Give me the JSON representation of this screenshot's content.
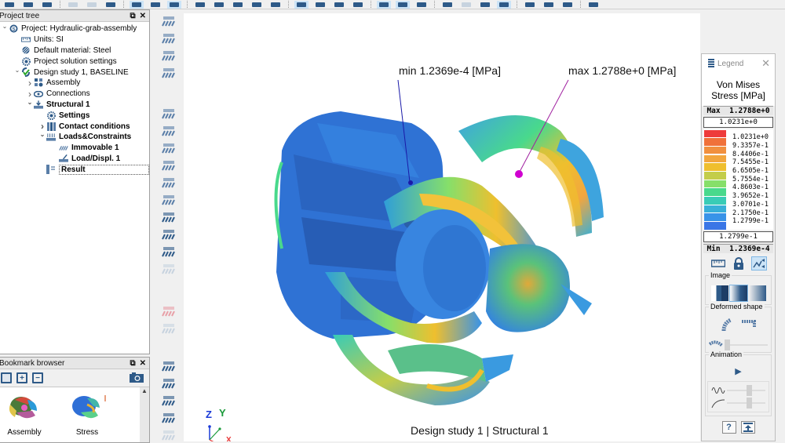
{
  "toolbar": {
    "buttons": [
      "select",
      "fit",
      "rotate",
      "pan",
      "zoom",
      "section",
      "view-list",
      "comment",
      "display",
      "edges",
      "vertices",
      "orbit",
      "undo-view",
      "redo-view",
      "render",
      "solid",
      "wire",
      "surface",
      "probe",
      "isolate",
      "more",
      "result-mode",
      "result-plot",
      "split",
      "animate",
      "scale",
      "deform",
      "sphere",
      "more"
    ]
  },
  "project_tree": {
    "title": "Project tree",
    "items": [
      {
        "label": "Project: Hydraulic-grab-assembly",
        "icon": "project-icon",
        "level": 0,
        "expanded": true,
        "bold": false
      },
      {
        "label": "Units: SI",
        "icon": "ruler-icon",
        "level": 1,
        "bold": false
      },
      {
        "label": "Default material: Steel",
        "icon": "material-icon",
        "level": 1,
        "bold": false
      },
      {
        "label": "Project solution settings",
        "icon": "gear-icon",
        "level": 1,
        "bold": false
      },
      {
        "label": "Design study 1, BASELINE",
        "icon": "design-study-icon",
        "level": 1,
        "expanded": true,
        "bold": false
      },
      {
        "label": "Assembly",
        "icon": "assembly-icon",
        "level": 2,
        "expanded": false,
        "bold": false
      },
      {
        "label": "Connections",
        "icon": "connections-icon",
        "level": 2,
        "expanded": false,
        "bold": false
      },
      {
        "label": "Structural  1",
        "icon": "structural-icon",
        "level": 2,
        "expanded": true,
        "bold": true
      },
      {
        "label": "Settings",
        "icon": "gear-icon",
        "level": 3,
        "bold": true
      },
      {
        "label": "Contact conditions",
        "icon": "contact-icon",
        "level": 3,
        "expanded": false,
        "bold": true
      },
      {
        "label": "Loads&Constraints",
        "icon": "loads-icon",
        "level": 3,
        "expanded": true,
        "bold": true
      },
      {
        "label": "Immovable 1",
        "icon": "immovable-icon",
        "level": 4,
        "bold": true
      },
      {
        "label": "Load/Displ. 1",
        "icon": "load-icon",
        "level": 4,
        "bold": true
      },
      {
        "label": "Result",
        "icon": "result-icon",
        "level": 3,
        "bold": true,
        "selected": true
      }
    ]
  },
  "bookmark_browser": {
    "title": "Bookmark browser",
    "items": [
      {
        "label": "Assembly"
      },
      {
        "label": "Stress"
      }
    ]
  },
  "viewport": {
    "min_annotation": "min  1.2369e-4  [MPa]",
    "max_annotation": "max  1.2788e+0  [MPa]",
    "study_label": "Design study 1 | Structural  1",
    "axes": {
      "z": "Z",
      "y": "Y",
      "x": "X"
    }
  },
  "legend": {
    "title": "Legend",
    "quantity": "Von Mises",
    "unit": "Stress [MPa]",
    "max_label": "Max",
    "max_value": "1.2788e+0",
    "upper_input": "1.0231e+0",
    "lower_input": "1.2799e-1",
    "min_label": "Min",
    "min_value": "1.2369e-4",
    "scale": [
      {
        "color": "#ee3b3b",
        "value": "1.0231e+0"
      },
      {
        "color": "#f0713a",
        "value": "9.3357e-1"
      },
      {
        "color": "#f1903f",
        "value": "8.4406e-1"
      },
      {
        "color": "#f2a63e",
        "value": "7.5455e-1"
      },
      {
        "color": "#efbf2e",
        "value": "6.6505e-1"
      },
      {
        "color": "#c3cd4a",
        "value": "5.7554e-1"
      },
      {
        "color": "#86df6a",
        "value": "4.8603e-1"
      },
      {
        "color": "#49d98c",
        "value": "3.9652e-1"
      },
      {
        "color": "#39ccb6",
        "value": "3.0701e-1"
      },
      {
        "color": "#38b0d8",
        "value": "2.1750e-1"
      },
      {
        "color": "#3893e8",
        "value": "1.2799e-1"
      },
      {
        "color": "#3a76e6",
        "value": ""
      }
    ],
    "image_label": "Image",
    "deformed_label": "Deformed shape",
    "animation_label": "Animation",
    "deform_slider": 0.0,
    "frequency_slider": 0.6,
    "speed_slider": 0.6
  },
  "colors": {
    "accent": "#2e5a88",
    "selection": "#cce4f7",
    "min_marker": "#1a1aa8",
    "max_marker": "#d000d0"
  }
}
